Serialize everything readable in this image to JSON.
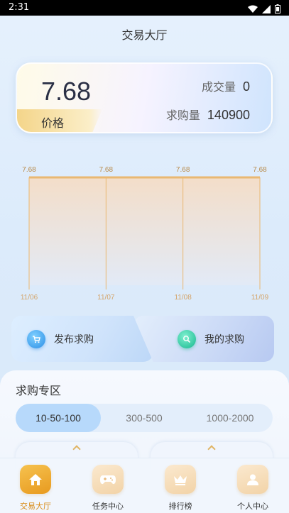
{
  "status_bar": {
    "time": "2:31"
  },
  "header": {
    "title": "交易大厅"
  },
  "price_card": {
    "price": "7.68",
    "price_label": "价格",
    "volume_label": "成交量",
    "volume_value": "0",
    "demand_label": "求购量",
    "demand_value": "140900"
  },
  "chart_data": {
    "type": "area",
    "x": [
      "11/06",
      "11/07",
      "11/08",
      "11/09"
    ],
    "series": [
      {
        "values": [
          7.68,
          7.68,
          7.68,
          7.68
        ]
      }
    ],
    "data_labels": [
      "7.68",
      "7.68",
      "7.68",
      "7.68"
    ],
    "colors": {
      "line": "#e9b872",
      "fill_top": "#f6dcc3",
      "fill_bottom": "#e3eaf6"
    }
  },
  "actions": {
    "publish_label": "发布求购",
    "mine_label": "我的求购"
  },
  "zone": {
    "title": "求购专区",
    "tabs": [
      {
        "label": "10-50-100"
      },
      {
        "label": "300-500"
      },
      {
        "label": "1000-2000"
      }
    ]
  },
  "nav": {
    "items": [
      {
        "label": "交易大厅",
        "icon": "home-icon"
      },
      {
        "label": "任务中心",
        "icon": "gamepad-icon"
      },
      {
        "label": "排行榜",
        "icon": "crown-icon"
      },
      {
        "label": "个人中心",
        "icon": "user-icon"
      }
    ]
  }
}
